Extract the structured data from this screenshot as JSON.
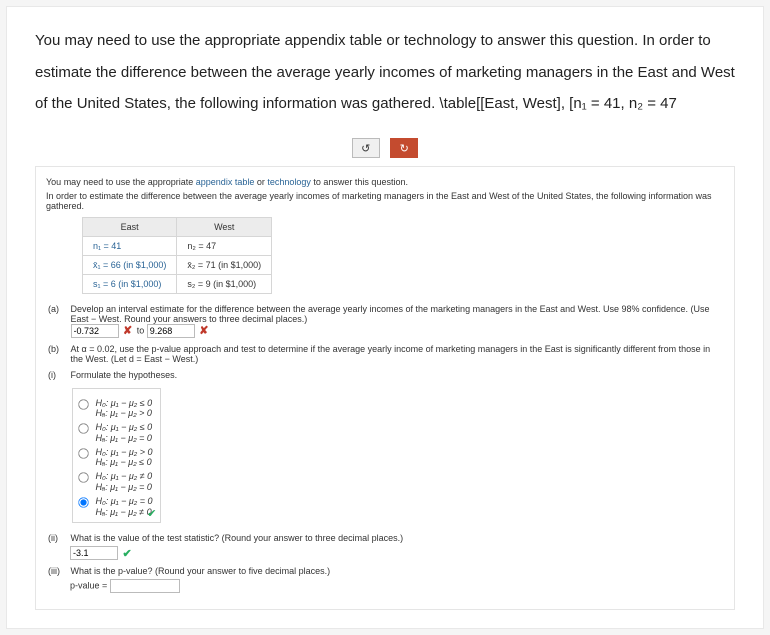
{
  "prompt": "You may need to use the appropriate appendix table or technology to answer this question. In order to estimate the difference between the average yearly incomes of marketing managers in the East and West of the United States, the following information was gathered. \\table[[East, West], [n₁ = 41, n₂ = 47",
  "buttons": {
    "reset_icon": "↺",
    "check_icon": "↻"
  },
  "inner": {
    "line1_a": "You may need to use the appropriate ",
    "appendix": "appendix table",
    "line1_b": " or ",
    "technology": "technology",
    "line1_c": " to answer this question.",
    "line2": "In order to estimate the difference between the average yearly incomes of marketing managers in the East and West of the United States, the following information was gathered."
  },
  "table": {
    "headers": {
      "east": "East",
      "west": "West"
    },
    "rows": [
      {
        "east": "n₁ = 41",
        "west": "n₂ = 47"
      },
      {
        "east": "x̄₁ = 66 (in $1,000)",
        "west": "x̄₂ = 71 (in $1,000)"
      },
      {
        "east": "s₁ = 6 (in $1,000)",
        "west": "s₂ = 9 (in $1,000)"
      }
    ]
  },
  "partA": {
    "label": "(a)",
    "text": "Develop an interval estimate for the difference between the average yearly incomes of the marketing managers in the East and West. Use 98% confidence. (Use East − West. Round your answers to three decimal places.)",
    "input1": "-0.732",
    "to": " to ",
    "input2": "9.268"
  },
  "partB": {
    "label": "(b)",
    "text": "At α = 0.02, use the p-value approach and test to determine if the average yearly income of marketing managers in the East is significantly different from those in the West. (Let d = East − West.)"
  },
  "partBi": {
    "label": "(i)",
    "text": "Formulate the hypotheses."
  },
  "hypotheses": [
    {
      "h0": "H₀: μ₁ − μ₂ ≤ 0",
      "ha": "Hₐ: μ₁ − μ₂ > 0"
    },
    {
      "h0": "H₀: μ₁ − μ₂ ≤ 0",
      "ha": "Hₐ: μ₁ − μ₂ = 0"
    },
    {
      "h0": "H₀: μ₁ − μ₂ > 0",
      "ha": "Hₐ: μ₁ − μ₂ ≤ 0"
    },
    {
      "h0": "H₀: μ₁ − μ₂ ≠ 0",
      "ha": "Hₐ: μ₁ − μ₂ = 0"
    },
    {
      "h0": "H₀: μ₁ − μ₂ = 0",
      "ha": "Hₐ: μ₁ − μ₂ ≠ 0"
    }
  ],
  "partBii": {
    "label": "(ii)",
    "text": "What is the value of the test statistic? (Round your answer to three decimal places.)",
    "value": "-3.1"
  },
  "partBiii": {
    "label": "(iii)",
    "text": "What is the p-value? (Round your answer to five decimal places.)",
    "pvalue_label": "p-value = ",
    "value": ""
  },
  "marks": {
    "wrong": "✘",
    "right": "✔"
  }
}
